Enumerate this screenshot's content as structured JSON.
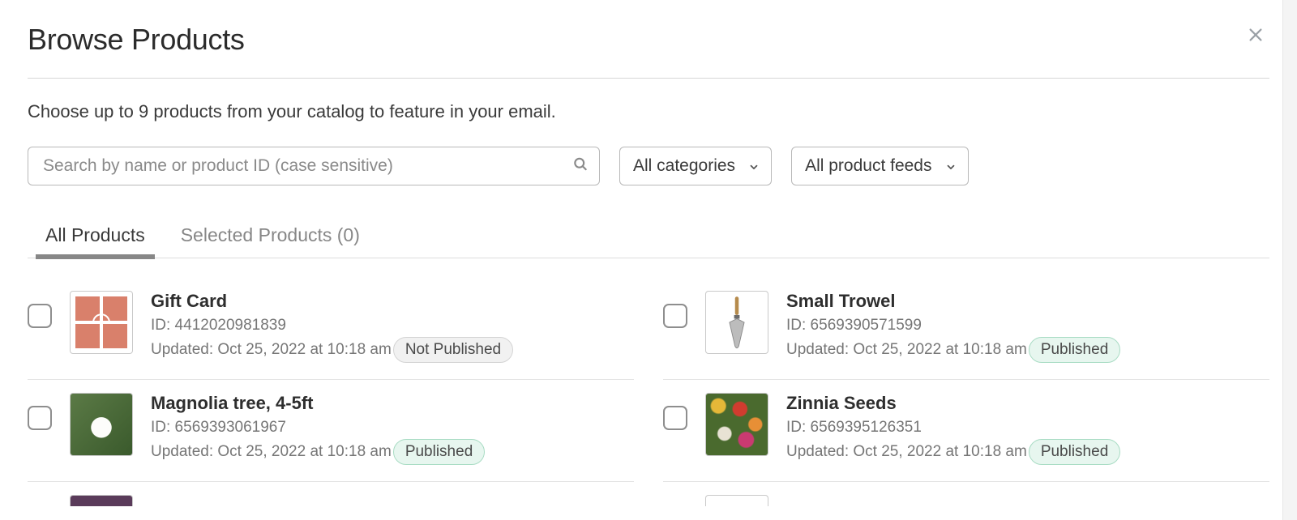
{
  "header": {
    "title": "Browse Products",
    "close_aria": "Close"
  },
  "subtitle": "Choose up to 9 products from your catalog to feature in your email.",
  "search": {
    "placeholder": "Search by name or product ID (case sensitive)",
    "value": ""
  },
  "filters": {
    "category": {
      "selected": "All categories"
    },
    "feed": {
      "selected": "All product feeds"
    }
  },
  "tabs": {
    "all_label": "All Products",
    "selected_label": "Selected Products (0)"
  },
  "status_labels": {
    "published": "Published",
    "not_published": "Not Published"
  },
  "products": [
    {
      "name": "Gift Card",
      "id_line": "ID: 4412020981839",
      "updated_line": "Updated: Oct 25, 2022 at 10:18 am",
      "status": "not_published",
      "thumb": "gift"
    },
    {
      "name": "Small Trowel",
      "id_line": "ID: 6569390571599",
      "updated_line": "Updated: Oct 25, 2022 at 10:18 am",
      "status": "published",
      "thumb": "trowel"
    },
    {
      "name": "Magnolia tree, 4-5ft",
      "id_line": "ID: 6569393061967",
      "updated_line": "Updated: Oct 25, 2022 at 10:18 am",
      "status": "published",
      "thumb": "magnolia"
    },
    {
      "name": "Zinnia Seeds",
      "id_line": "ID: 6569395126351",
      "updated_line": "Updated: Oct 25, 2022 at 10:18 am",
      "status": "published",
      "thumb": "zinnia"
    }
  ]
}
